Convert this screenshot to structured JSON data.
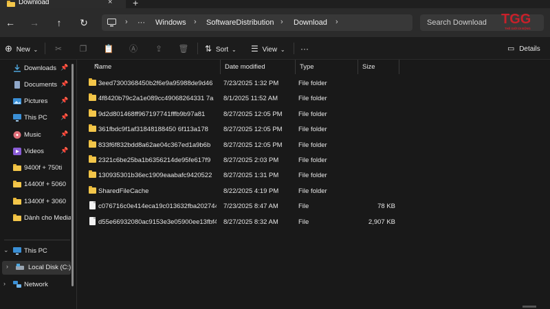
{
  "window": {
    "tab_title": "Download",
    "tab_close": "×",
    "new_tab": "+"
  },
  "nav": {
    "back": "←",
    "forward": "→",
    "up": "↑",
    "refresh": "↻"
  },
  "address": {
    "pc_icon": "monitor-icon",
    "ellipsis": "···",
    "crumbs": [
      "Windows",
      "SoftwareDistribution",
      "Download"
    ],
    "separator": "›"
  },
  "search": {
    "placeholder": "Search Download"
  },
  "logo": {
    "text": "TGG",
    "subtext": "THẾ GIỚI DI ĐỘNG"
  },
  "toolbar": {
    "new_label": "New",
    "sort_label": "Sort",
    "view_label": "View",
    "more": "···",
    "details_label": "Details"
  },
  "sidebar": {
    "items": [
      {
        "label": "Downloads",
        "icon": "download-icon",
        "pinned": true
      },
      {
        "label": "Documents",
        "icon": "documents-icon",
        "pinned": true
      },
      {
        "label": "Pictures",
        "icon": "pictures-icon",
        "pinned": true
      },
      {
        "label": "This PC",
        "icon": "monitor-icon",
        "pinned": true
      },
      {
        "label": "Music",
        "icon": "music-icon",
        "pinned": true
      },
      {
        "label": "Videos",
        "icon": "videos-icon",
        "pinned": true
      },
      {
        "label": "9400f + 750ti",
        "icon": "folder-icon",
        "pinned": false
      },
      {
        "label": "14400f + 5060",
        "icon": "folder-icon",
        "pinned": false
      },
      {
        "label": "13400f + 3060",
        "icon": "folder-icon",
        "pinned": false
      },
      {
        "label": "Dành cho Media",
        "icon": "folder-icon",
        "pinned": false
      }
    ],
    "tree": [
      {
        "label": "This PC",
        "expanded": true
      },
      {
        "label": "Local Disk (C:)",
        "expanded": false,
        "selected": true
      },
      {
        "label": "Network",
        "expanded": false
      }
    ]
  },
  "list": {
    "columns": [
      "Name",
      "Date modified",
      "Type",
      "Size"
    ],
    "rows": [
      {
        "name": "3eed7300368450b2f6e9a95988de9d46",
        "date": "7/23/2025 1:32 PM",
        "type": "File folder",
        "size": "",
        "kind": "folder"
      },
      {
        "name": "4f8420b79c2a1e089cc49068264331 7a",
        "date": "8/1/2025 11:52 AM",
        "type": "File folder",
        "size": "",
        "kind": "folder"
      },
      {
        "name": "9d2d801468ff967197741fffb9b97a81",
        "date": "8/27/2025 12:05 PM",
        "type": "File folder",
        "size": "",
        "kind": "folder"
      },
      {
        "name": "361fbdc9f1af31848188450 6f113a178",
        "date": "8/27/2025 12:05 PM",
        "type": "File folder",
        "size": "",
        "kind": "folder"
      },
      {
        "name": "833f6f832bdd8a62ae04c367ed1a9b6b",
        "date": "8/27/2025 12:05 PM",
        "type": "File folder",
        "size": "",
        "kind": "folder"
      },
      {
        "name": "2321c6be25ba1b6356214de95fe617f9",
        "date": "8/27/2025 2:03 PM",
        "type": "File folder",
        "size": "",
        "kind": "folder"
      },
      {
        "name": "130935301b36ec1909eaabafc9420522",
        "date": "8/27/2025 1:31 PM",
        "type": "File folder",
        "size": "",
        "kind": "folder"
      },
      {
        "name": "SharedFileCache",
        "date": "8/22/2025 4:19 PM",
        "type": "File folder",
        "size": "",
        "kind": "folder"
      },
      {
        "name": "c076716c0e414eca19c013632fba202744...",
        "date": "7/23/2025 8:47 AM",
        "type": "File",
        "size": "78 KB",
        "kind": "file"
      },
      {
        "name": "d55e66932080ac9153e3e05900ee13fbf4...",
        "date": "8/27/2025 8:32 AM",
        "type": "File",
        "size": "2,907 KB",
        "kind": "file"
      }
    ]
  },
  "colors": {
    "accent_red": "#c8202a",
    "folder_yellow": "#f3c64a",
    "background": "#191919"
  }
}
